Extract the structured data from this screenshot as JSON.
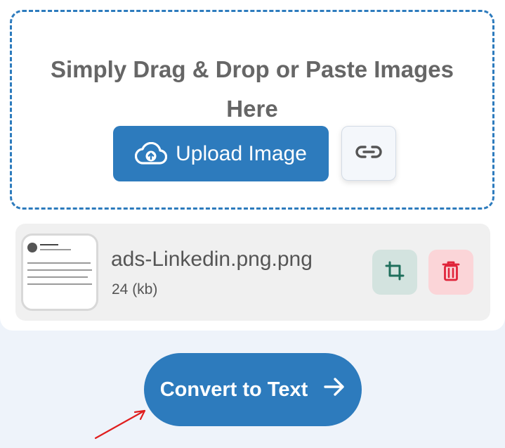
{
  "dropzone": {
    "text": "Simply Drag & Drop or Paste Images Here",
    "upload_label": "Upload Image",
    "upload_icon": "cloud-upload-icon",
    "link_icon": "link-icon"
  },
  "file": {
    "name": "ads-Linkedin.png.png",
    "size": "24 (kb)",
    "crop_icon": "crop-icon",
    "delete_icon": "trash-icon"
  },
  "actions": {
    "convert_label": "Convert to Text",
    "convert_icon": "arrow-right-icon"
  },
  "colors": {
    "primary": "#2d7bbd",
    "crop_bg": "#d3e3df",
    "crop_fg": "#1f6f5c",
    "delete_bg": "#fbd5d8",
    "delete_fg": "#e0243a",
    "annotation": "#e01e1e"
  }
}
